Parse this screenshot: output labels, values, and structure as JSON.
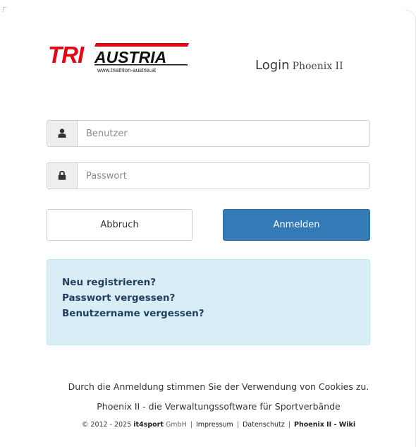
{
  "logo": {
    "text_tri": "TRI",
    "text_austria": "AUSTRIA",
    "url": "www.triathlon-austria.at",
    "brand_red": "#e30613"
  },
  "header": {
    "title": "Login",
    "subtitle": "Phoenix II"
  },
  "form": {
    "username_placeholder": "Benutzer",
    "password_placeholder": "Passwort",
    "username_icon": "user-icon",
    "password_icon": "lock-icon"
  },
  "buttons": {
    "cancel_label": "Abbruch",
    "login_label": "Anmelden",
    "login_color": "#337ab7"
  },
  "links": {
    "register": "Neu registrieren?",
    "forgot_password": "Passwort vergessen?",
    "forgot_username": "Benutzername vergessen?"
  },
  "footer": {
    "cookie_notice": "Durch die Anmeldung stimmen Sie der Verwendung von Cookies zu.",
    "tagline": "Phoenix II - die Verwaltungssoftware für Sportverbände",
    "copyright_prefix": "© 2012 - 2025",
    "company_bold": "it4sport",
    "company_suffix": "GmbH",
    "separator": "|",
    "impressum": "Impressum",
    "datenschutz": "Datenschutz",
    "wiki": "Phoenix II - Wiki"
  }
}
